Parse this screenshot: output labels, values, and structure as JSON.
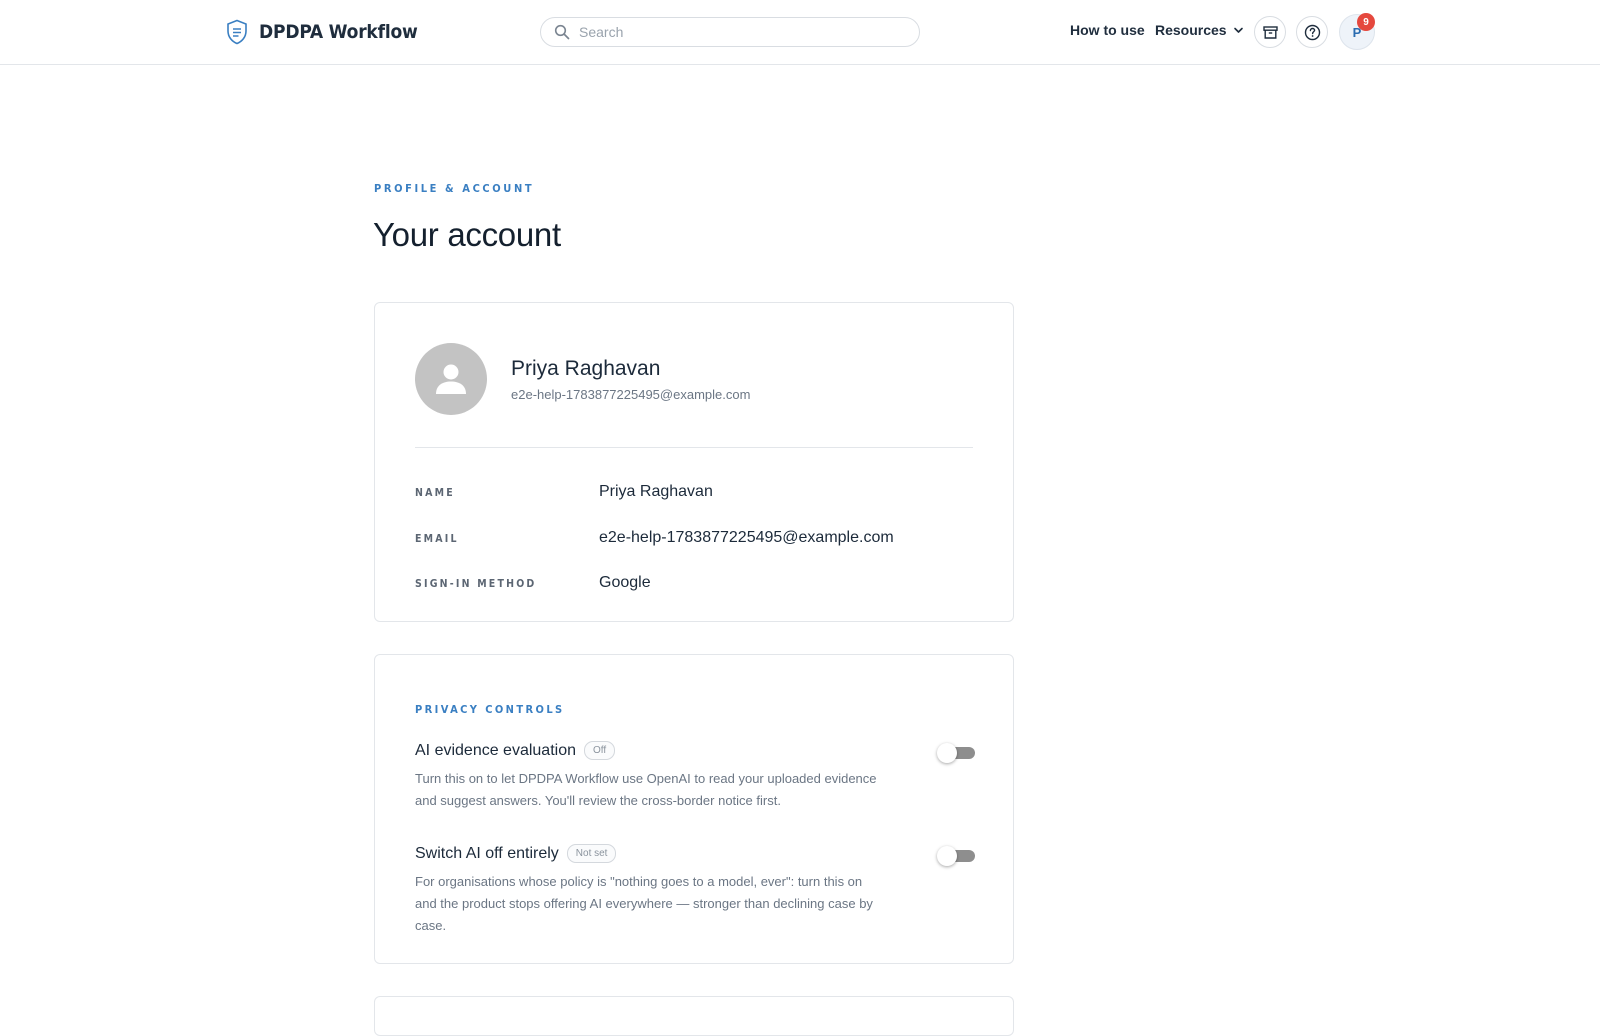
{
  "app": {
    "name": "DPDPA Workflow",
    "search_placeholder": "Search",
    "nav": {
      "how_to_use": "How to use",
      "resources": "Resources"
    },
    "user_initial": "P",
    "notification_count": "9"
  },
  "page": {
    "eyebrow": "PROFILE & ACCOUNT",
    "title": "Your account"
  },
  "profile": {
    "display_name": "Priya Raghavan",
    "email": "e2e-help-1783877225495@example.com",
    "fields": {
      "name_label": "NAME",
      "name_value": "Priya Raghavan",
      "email_label": "EMAIL",
      "email_value": "e2e-help-1783877225495@example.com",
      "signin_label": "SIGN-IN METHOD",
      "signin_value": "Google"
    }
  },
  "privacy": {
    "eyebrow": "PRIVACY CONTROLS",
    "ai_evidence": {
      "title": "AI evidence evaluation",
      "status": "Off",
      "description": "Turn this on to let DPDPA Workflow use OpenAI to read your uploaded evidence and suggest answers. You'll review the cross-border notice first.",
      "enabled": false
    },
    "ai_off": {
      "title": "Switch AI off entirely",
      "status": "Not set",
      "description": "For organisations whose policy is \"nothing goes to a model, ever\": turn this on and the product stops offering AI everywhere — stronger than declining case by case.",
      "enabled": false
    }
  },
  "colors": {
    "accent": "#3a7fc2",
    "badge": "#e5483e",
    "toggle_off": "#8e8e8e"
  },
  "icons": {
    "brand": "shield-document-icon",
    "search": "search-icon",
    "resources": "chevron-down-icon",
    "archive": "archive-icon",
    "help": "help-circle-icon",
    "avatar": "user-silhouette-icon"
  }
}
